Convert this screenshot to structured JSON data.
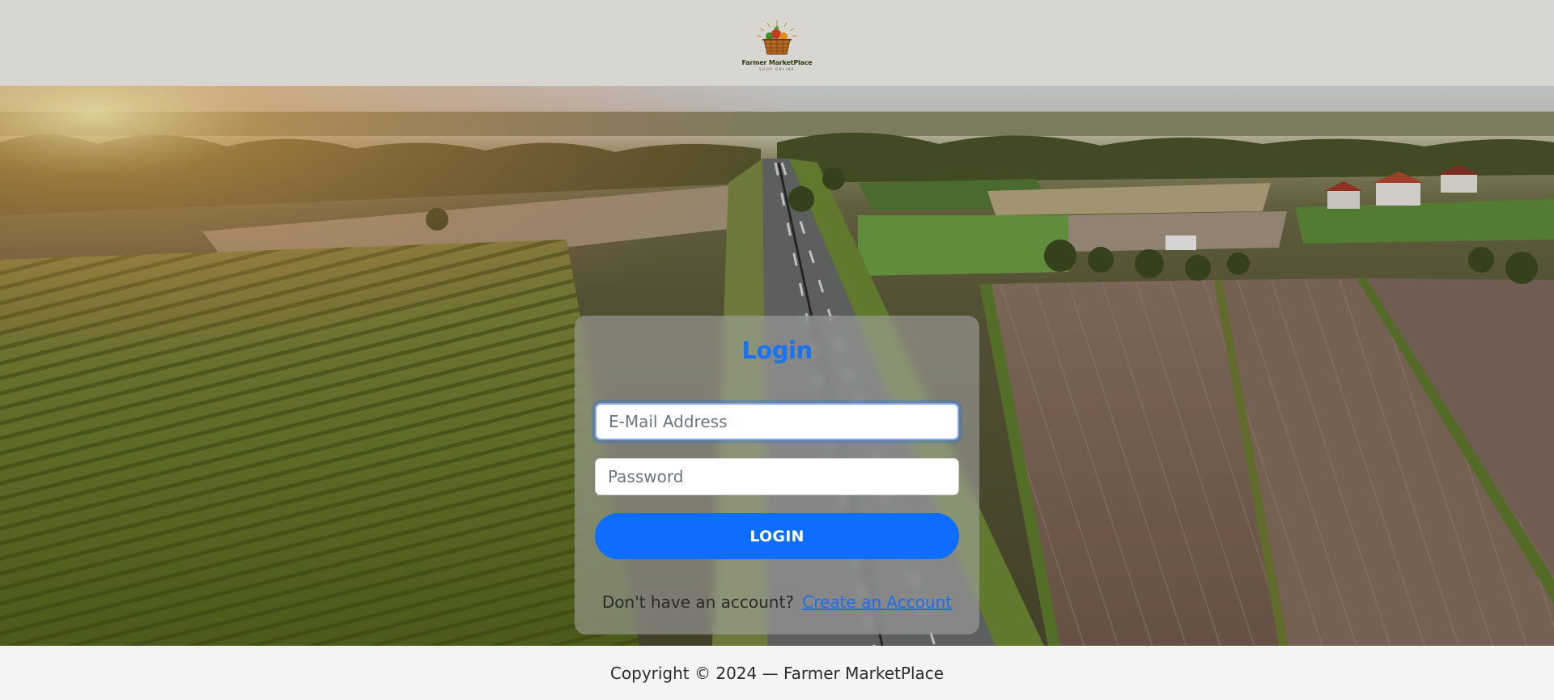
{
  "header": {
    "logo_name": "Farmer MarketPlace",
    "logo_tagline": "SHOP ONLINE"
  },
  "login": {
    "title": "Login",
    "email_placeholder": "E-Mail Address",
    "password_placeholder": "Password",
    "submit_label": "LOGIN",
    "no_account_text": "Don't have an account?",
    "create_account_link": "Create an Account"
  },
  "footer": {
    "copyright": "Copyright © 2024 — Farmer MarketPlace"
  },
  "colors": {
    "accent": "#0d6efd",
    "title": "#1a73f0",
    "header_bg": "#d8d6d1",
    "footer_bg": "#f4f4f3"
  },
  "icons": {
    "logo": "basket-logo-icon"
  }
}
